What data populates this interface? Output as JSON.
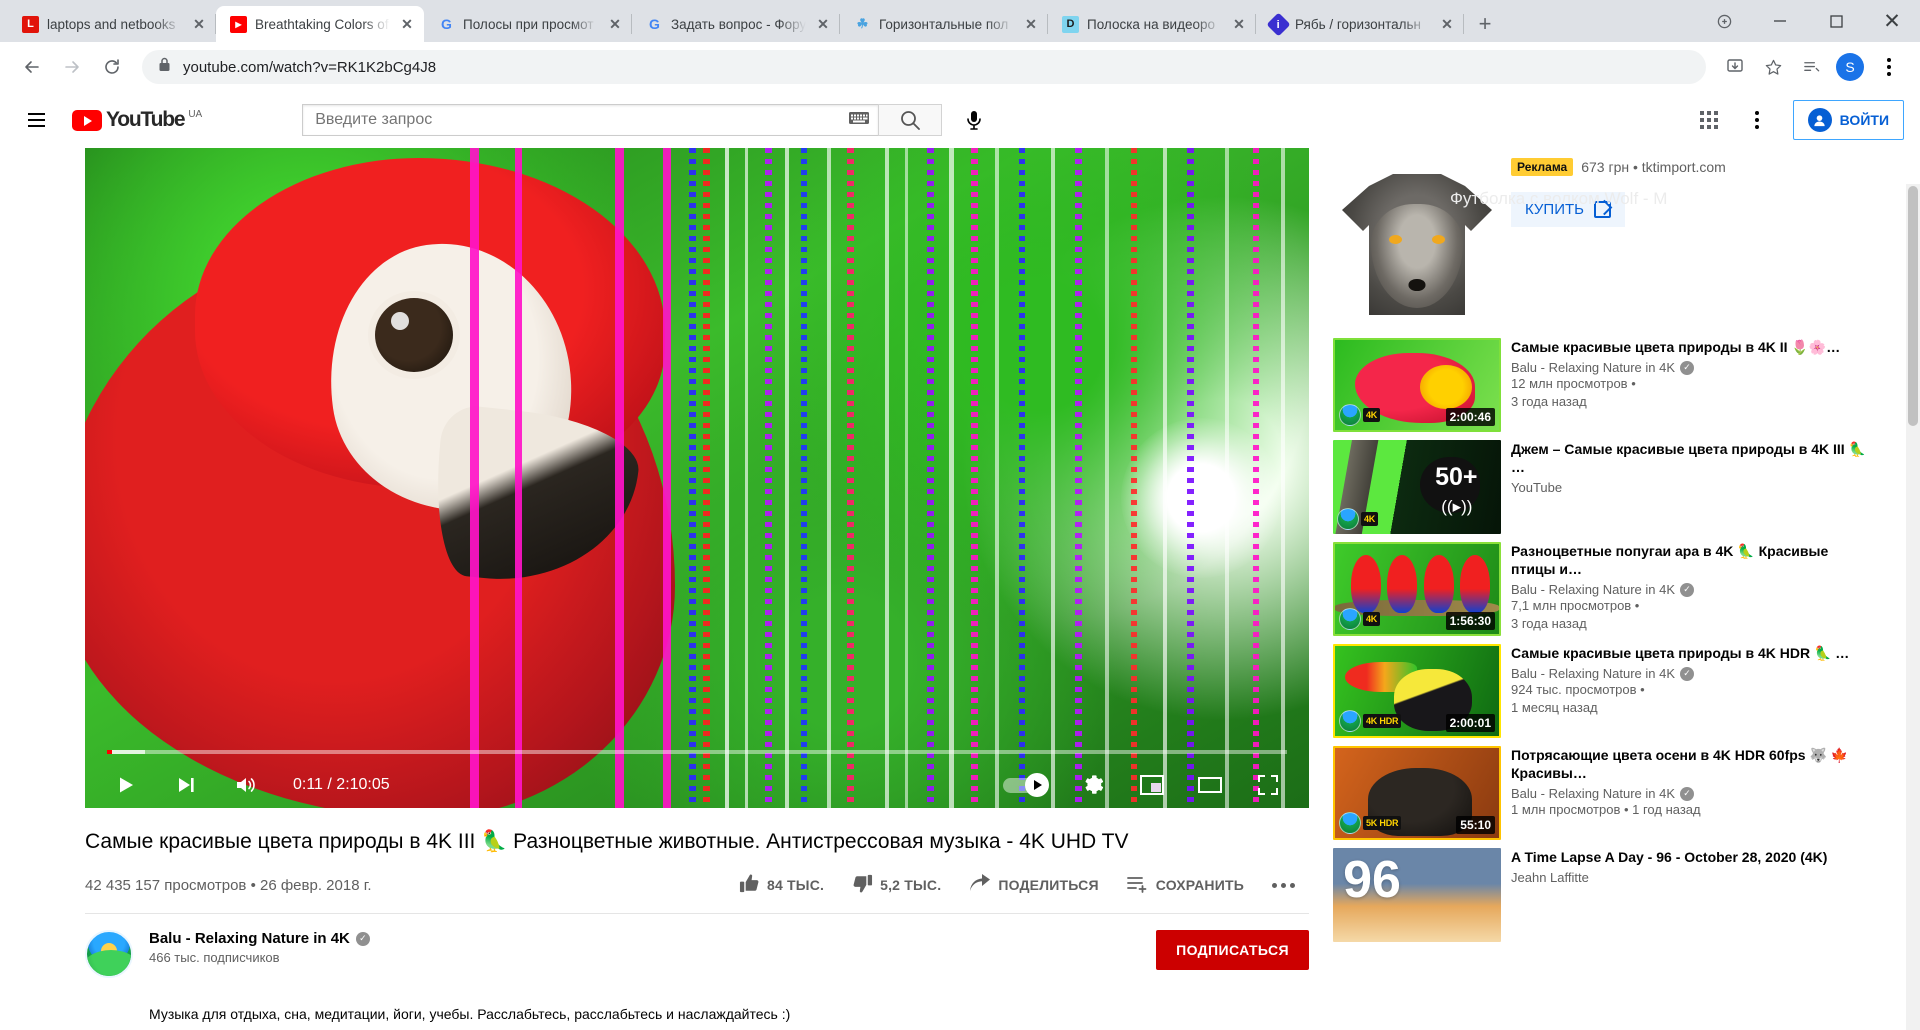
{
  "browser": {
    "tabs": [
      {
        "title": "laptops and netbooks",
        "favicon": "lenovo-icon",
        "favicon_char": "L",
        "favicon_bg": "#e1140a",
        "favicon_fg": "#ffffff",
        "active": false
      },
      {
        "title": "Breathtaking Colors of",
        "favicon": "youtube-icon",
        "favicon_char": "▶",
        "favicon_bg": "#ff0000",
        "favicon_fg": "#ffffff",
        "active": true
      },
      {
        "title": "Полосы при просмот",
        "favicon": "google-icon",
        "favicon_char": "G",
        "favicon_bg": "#ffffff",
        "favicon_fg": "#4285f4",
        "active": false
      },
      {
        "title": "Задать вопрос - Фору",
        "favicon": "google-icon",
        "favicon_char": "G",
        "favicon_bg": "#ffffff",
        "favicon_fg": "#4285f4",
        "active": false
      },
      {
        "title": "Горизонтальные пол",
        "favicon": "forum-icon",
        "favicon_char": "☘",
        "favicon_bg": "#ffffff",
        "favicon_fg": "#4aa3e0",
        "active": false
      },
      {
        "title": "Полоска на видеоро",
        "favicon": "dxdiag-icon",
        "favicon_char": "D",
        "favicon_bg": "#7fd4ef",
        "favicon_fg": "#1b1b1b",
        "active": false
      },
      {
        "title": "Рябь / горизонтальн",
        "favicon": "info-icon",
        "favicon_char": "i",
        "favicon_bg": "#3a2fd0",
        "favicon_fg": "#ffffff",
        "active": false
      }
    ],
    "new_tab_label": "+",
    "window_controls": {
      "minimize": "—",
      "maximize": "❐",
      "close": "✕"
    },
    "nav": {
      "back": "←",
      "forward": "→",
      "reload": "⟳"
    },
    "address": {
      "lock": "🔒",
      "url": "youtube.com/watch?v=RK1K2bCg4J8"
    },
    "toolbar_icons": {
      "install": "install-icon",
      "bookmark": "☆",
      "reading_list": "reading-list-icon",
      "menu": "⋮"
    },
    "profile_initial": "S"
  },
  "youtube": {
    "logo_text": "YouTube",
    "logo_country": "UA",
    "search": {
      "placeholder": "Введите запрос",
      "value": ""
    },
    "signin_label": "ВОЙТИ",
    "background_ad_text": "Футболка с волком Wolf - M"
  },
  "player": {
    "current_time": "0:11",
    "total_time": "2:10:05",
    "time_display": "0:11 / 2:10:05",
    "progress_percent": 0.45,
    "buffered_percent": 3.2,
    "controls": [
      "play-button",
      "next-button",
      "volume-button",
      "autoplay-toggle",
      "settings-button",
      "miniplayer-button",
      "theater-button",
      "fullscreen-button"
    ]
  },
  "video": {
    "title": "Самые красивые цвета природы в 4K III 🦜 Разноцветные животные. Антистрессовая музыка - 4K UHD TV",
    "views": "42 435 157 просмотров",
    "date": "26 февр. 2018 г.",
    "views_and_date": "42 435 157 просмотров • 26 февр. 2018 г.",
    "likes": "84 ТЫС.",
    "dislikes": "5,2 ТЫС.",
    "share_label": "ПОДЕЛИТЬСЯ",
    "save_label": "СОХРАНИТЬ",
    "channel_name": "Balu - Relaxing Nature in 4K",
    "channel_subs": "466 тыс. подписчиков",
    "subscribe_label": "ПОДПИСАТЬСЯ",
    "description": "Музыка для отдыха, сна, медитации, йоги, учебы. Расслабьтесь, расслабьтесь и наслаждайтесь :)"
  },
  "sidebar": {
    "ad": {
      "badge": "Реклама",
      "price_and_site": "673 грн • tktimport.com",
      "cta_label": "КУПИТЬ",
      "image": "wolf-tshirt-image"
    },
    "recommendations": [
      {
        "title": "Самые красивые цвета природы в 4K II 🌷🌸…",
        "channel": "Balu - Relaxing Nature in 4K",
        "verified": true,
        "views": "12 млн просмотров •",
        "age": "3 года назад",
        "duration": "2:00:46",
        "quality_tag": "4K",
        "thumb": "flower-bee-thumbnail"
      },
      {
        "title": "Джем – Самые красивые цвета природы в 4K III 🦜 …",
        "channel": "YouTube",
        "verified": false,
        "views": "",
        "age": "",
        "duration": "",
        "overlay_text": "50+",
        "quality_tag": "4K",
        "thumb": "toucan-mix-thumbnail"
      },
      {
        "title": "Разноцветные попугаи ара в 4K 🦜 Красивые птицы и…",
        "channel": "Balu - Relaxing Nature in 4K",
        "verified": true,
        "views": "7,1 млн просмотров •",
        "age": "3 года назад",
        "duration": "1:56:30",
        "quality_tag": "4K",
        "thumb": "macaws-thumbnail"
      },
      {
        "title": "Самые красивые цвета природы в 4K HDR 🦜 …",
        "channel": "Balu - Relaxing Nature in 4K",
        "verified": true,
        "views": "924 тыс. просмотров •",
        "age": "1 месяц назад",
        "duration": "2:00:01",
        "quality_tag": "4K HDR",
        "thumb": "toucan-thumbnail"
      },
      {
        "title": "Потрясающие цвета осени в 4K HDR 60fps 🐺 🍁 Красивы…",
        "channel": "Balu - Relaxing Nature in 4K",
        "verified": true,
        "views": "1 млн просмотров • 1 год назад",
        "age": "",
        "duration": "55:10",
        "quality_tag": "5K HDR",
        "thumb": "bear-autumn-thumbnail"
      },
      {
        "title": "A Time Lapse A Day - 96 - October 28, 2020 (4K)",
        "channel": "Jeahn Laffitte",
        "verified": false,
        "views": "",
        "age": "",
        "duration": "",
        "overlay_text": "96",
        "quality_tag": "",
        "thumb": "timelapse-sky-thumbnail"
      }
    ]
  },
  "colors": {
    "youtube_red": "#ff0000",
    "subscribe_red": "#cc0000",
    "link_blue": "#065fd4",
    "ad_yellow": "#ffcc33",
    "text_primary": "#030303",
    "text_secondary": "#606060"
  }
}
